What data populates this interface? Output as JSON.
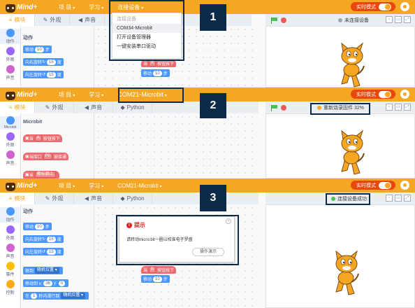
{
  "logo_text": "Mind+",
  "steps": [
    "1",
    "2",
    "3"
  ],
  "panel1": {
    "menus": [
      "项 目",
      "学习",
      "连接设备"
    ],
    "realtime_label": "实时模式",
    "tabs": [
      "模块",
      "外观",
      "声音"
    ],
    "connection_status": "未连接设备",
    "dropdown": [
      "连接设备",
      "COM34-Microbit",
      "打开设备管理器",
      "一键安装串口驱动"
    ],
    "categories": [
      "动作",
      "外观",
      "声音"
    ],
    "section_title": "动作",
    "blocks": [
      "移动",
      "向右旋转",
      "向左旋转"
    ],
    "block_values": [
      "10",
      "15",
      "15"
    ],
    "block_unit_steps": "步",
    "block_unit_deg": "度",
    "ws_event_prefix": "当",
    "ws_event_key": "A",
    "ws_event_suffix": "按钮按下",
    "ws_move": "移动",
    "ws_move_val": "10"
  },
  "panel2": {
    "menus": [
      "项 目",
      "学习",
      "COM21-Microbit"
    ],
    "realtime_label": "实时模式",
    "tabs": [
      "模块",
      "外观",
      "声音",
      "Python"
    ],
    "connection_status": "重新烧录固件 32%",
    "categories": [
      "Microbit",
      "外观",
      "声音"
    ],
    "section_title": "Microbit",
    "blocks": [
      {
        "prefix": "当",
        "dropdown": "A",
        "suffix": "按钮按下"
      },
      {
        "prefix": "当接口",
        "dropdown": "P0",
        "suffix": "被接通"
      },
      {
        "prefix": "当",
        "dropdown": "徽标朝上",
        "suffix": ""
      }
    ]
  },
  "panel3": {
    "menus": [
      "项 目",
      "学习",
      "COM21-Microbit"
    ],
    "realtime_label": "实时模式",
    "tabs": [
      "模块",
      "外观",
      "声音",
      "Python"
    ],
    "connection_status": "连接设备成功",
    "categories": [
      "动作",
      "外观",
      "声音",
      "事件",
      "控制"
    ],
    "section_title": "动作",
    "blocks": [
      "移动",
      "向右旋转",
      "向左旋转",
      "移到",
      "移动到 x:",
      "在"
    ],
    "block_values": [
      "10",
      "15",
      "15",
      "随机位置",
      "36",
      "0",
      "1",
      "随机位置"
    ],
    "block_unit_steps": "步",
    "block_unit_deg": "度",
    "block_y_label": "y:",
    "block_glide_mid": "秒内滑行到",
    "dialog": {
      "title": "提示",
      "message": "请转动micro:bit一圈以校准电子罗盘",
      "button": "操作演示",
      "close": "×"
    },
    "ws_event_prefix": "当",
    "ws_event_key": "B",
    "ws_event_suffix": "按钮按下",
    "ws_move": "移动",
    "ws_move_val": "10"
  },
  "colors": {
    "topbar": "#f5a623",
    "realtime": "#e8470d",
    "callout": "#0b2a4a",
    "motion": "#4c97ff",
    "microbit": "#ed6b70",
    "status_orange": "#f5a623",
    "status_green": "#4cbf56",
    "status_gray": "#9aa6b2"
  }
}
